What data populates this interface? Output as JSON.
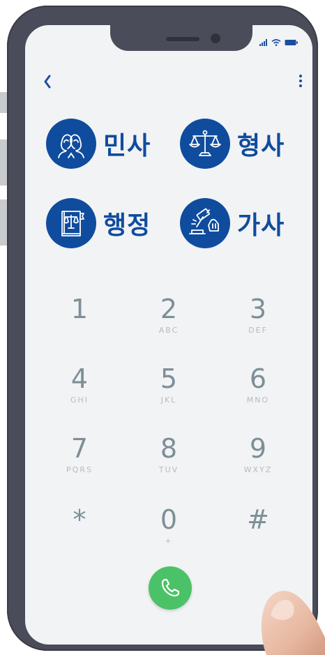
{
  "header": {
    "back_icon": "chevron-left-icon",
    "menu_icon": "vertical-dots-icon"
  },
  "categories": [
    {
      "label": "민사",
      "icon": "two-people-icon"
    },
    {
      "label": "형사",
      "icon": "scales-of-justice-icon"
    },
    {
      "label": "행정",
      "icon": "law-book-icon"
    },
    {
      "label": "가사",
      "icon": "gavel-icon"
    }
  ],
  "keypad": [
    {
      "digit": "1",
      "letters": ""
    },
    {
      "digit": "2",
      "letters": "ABC"
    },
    {
      "digit": "3",
      "letters": "DEF"
    },
    {
      "digit": "4",
      "letters": "GHI"
    },
    {
      "digit": "5",
      "letters": "JKL"
    },
    {
      "digit": "6",
      "letters": "MNO"
    },
    {
      "digit": "7",
      "letters": "PQRS"
    },
    {
      "digit": "8",
      "letters": "TUV"
    },
    {
      "digit": "9",
      "letters": "WXYZ"
    },
    {
      "digit": "*",
      "letters": ""
    },
    {
      "digit": "0",
      "letters": "+"
    },
    {
      "digit": "#",
      "letters": ""
    }
  ],
  "call_icon": "phone-handset-icon",
  "colors": {
    "brand_blue": "#0f4c9e",
    "call_green": "#4bc267",
    "digit_gray": "#7d8f97",
    "screen_bg": "#f2f3f5",
    "phone_frame": "#4a4c59"
  }
}
